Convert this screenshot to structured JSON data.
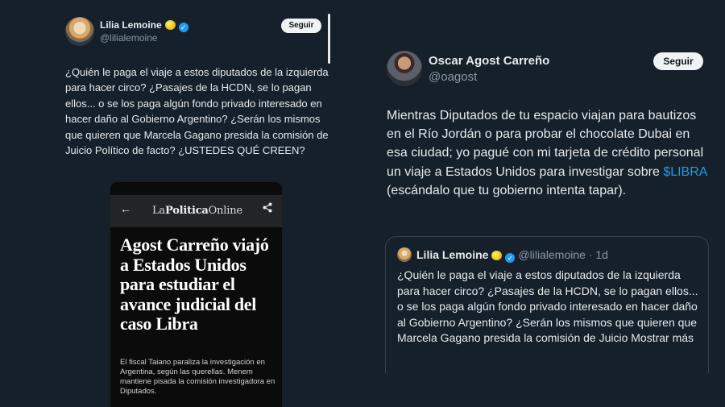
{
  "left_tweet": {
    "author_name": "Lilia Lemoine",
    "author_handle": "@lilialemoine",
    "follow_label": "Seguir",
    "text": "¿Quién le paga el viaje a estos diputados de la izquierda para hacer circo? ¿Pasajes de la HCDN, se lo pagan ellos... o se los paga algún fondo privado interesado en hacer daño al Gobierno Argentino? ¿Serán los mismos que quieren que Marcela Gagano presida la  comisión de Juicio Político de facto? ¿USTEDES QUÉ CREEN?",
    "media": {
      "back_icon": "←",
      "brand_part1": "La",
      "brand_part2": "Politica",
      "brand_part3": "Online",
      "share_icon": "⋖",
      "headline": "Agost Carreño viajó a Estados Unidos para estudiar el avance judicial del caso Libra",
      "summary": "El fiscal Taiano paraliza la investigación en Argentina, según las querellas. Menem mantiene pisada la comisión investigadora en Diputados."
    }
  },
  "right_tweet": {
    "author_name": "Oscar Agost Carreño",
    "author_handle": "@oagost",
    "follow_label": "Seguir",
    "text_before_link": "Mientras Diputados de tu espacio viajan para bautizos en el Río Jordán o para probar el chocolate Dubai en esa ciudad; yo pagué con mi tarjeta de crédito personal un viaje a Estados Unidos para investigar sobre ",
    "link_text": "$LIBRA",
    "text_after_link": " (escándalo que tu gobierno intenta tapar).",
    "quote": {
      "author_name": "Lilia Lemoine",
      "meta": "@lilialemoine · 1d",
      "text": "¿Quién le paga el viaje a estos diputados de la izquierda para hacer circo? ¿Pasajes de la HCDN, se lo pagan ellos... o se los paga algún fondo privado interesado en hacer daño al Gobierno Argentino? ¿Serán los mismos que quieren que Marcela Gagano presida la  comisión de Juicio ",
      "show_more": "Mostrar más"
    }
  },
  "colors": {
    "background": "#15202b",
    "text": "#e7e9ea",
    "muted": "#8b98a5",
    "link": "#1d9bf0",
    "verified": "#1d9bf0"
  },
  "icons": [
    "verified-badge-icon",
    "lemon-emoji-icon",
    "back-arrow-icon",
    "share-icon"
  ]
}
